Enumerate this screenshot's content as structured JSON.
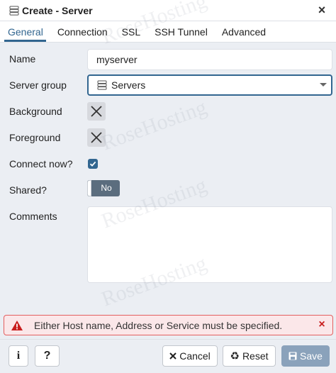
{
  "dialog": {
    "title": "Create - Server",
    "close_label": "×"
  },
  "tabs": [
    {
      "label": "General",
      "active": true
    },
    {
      "label": "Connection",
      "active": false
    },
    {
      "label": "SSL",
      "active": false
    },
    {
      "label": "SSH Tunnel",
      "active": false
    },
    {
      "label": "Advanced",
      "active": false
    }
  ],
  "form": {
    "name": {
      "label": "Name",
      "value": "myserver"
    },
    "server_group": {
      "label": "Server group",
      "value": "Servers"
    },
    "background": {
      "label": "Background"
    },
    "foreground": {
      "label": "Foreground"
    },
    "connect_now": {
      "label": "Connect now?",
      "checked": true
    },
    "shared": {
      "label": "Shared?",
      "value": "No"
    },
    "comments": {
      "label": "Comments",
      "value": ""
    }
  },
  "error": {
    "message": "Either Host name, Address or Service must be specified.",
    "close_label": "×"
  },
  "footer": {
    "info_label": "i",
    "help_label": "?",
    "cancel_label": "Cancel",
    "reset_label": "Reset",
    "save_label": "Save"
  },
  "watermark": "RoseHosting",
  "colors": {
    "accent": "#326690",
    "error_border": "#e35f5f",
    "error_bg": "#fbe7e9",
    "save_disabled": "#8aa2bb",
    "toggle_bg": "#5b6d7e"
  }
}
